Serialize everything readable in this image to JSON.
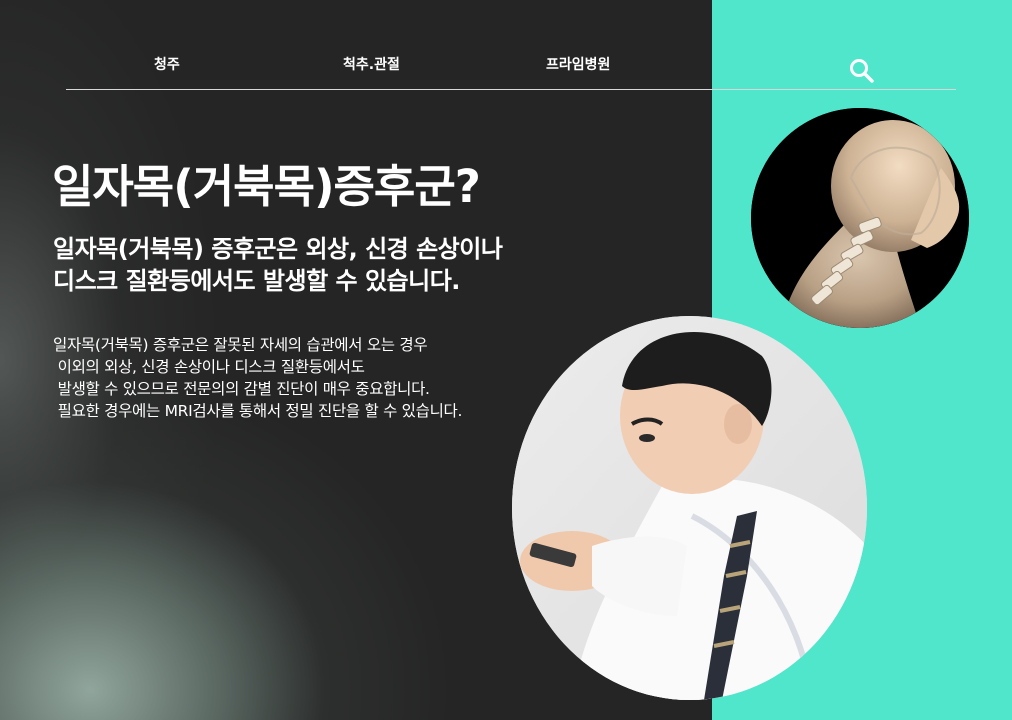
{
  "nav": {
    "items": [
      "청주",
      "척추.관절",
      "프라임병원"
    ],
    "search_icon": "search-icon"
  },
  "hero": {
    "title": "일자목(거북목)증후군?",
    "subtitle_lines": [
      "일자목(거북목) 증후군은 외상, 신경 손상이나",
      "디스크 질환등에서도 발생할 수 있습니다."
    ],
    "body_lines": [
      "일자목(거북목) 증후군은 잘못된 자세의 습관에서 오는 경우",
      " 이외의 외상, 신경 손상이나 디스크 질환등에서도",
      " 발생할 수 있으므로 전문의의 감별 진단이 매우 중요합니다.",
      " 필요한 경우에는 MRI검사를 통해서 정밀 진단을 할 수 있습니다."
    ]
  },
  "images": {
    "neck_xray": "neck-skeleton-illustration",
    "man_phone": "man-hunched-over-phone-photo"
  },
  "colors": {
    "teal": "#4fe6cb",
    "dark": "#252525",
    "text": "#ffffff"
  }
}
